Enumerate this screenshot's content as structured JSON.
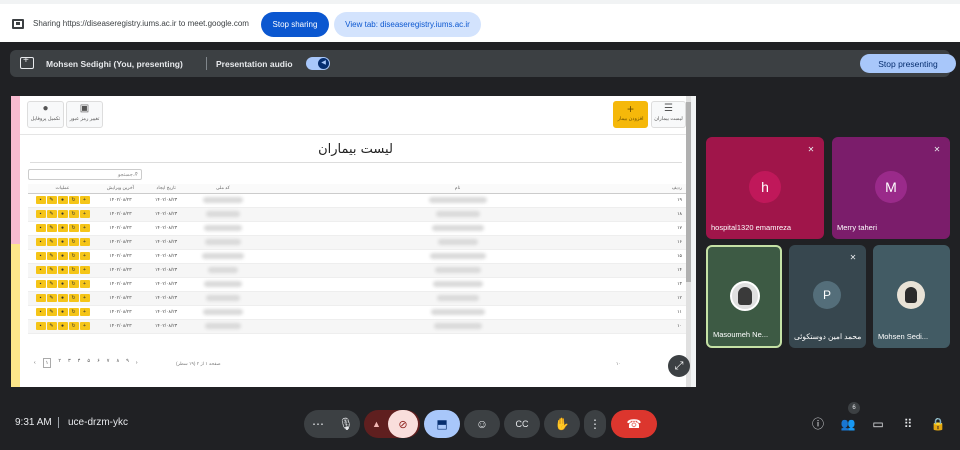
{
  "sharing_bar": {
    "message": "Sharing https://diseaseregistry.iums.ac.ir to meet.google.com",
    "stop_sharing": "Stop sharing",
    "view_tab": "View tab: diseaseregistry.iums.ac.ir"
  },
  "presenting_bar": {
    "presenter": "Mohsen Sedighi (You, presenting)",
    "audio_label": "Presentation audio",
    "stop_presenting": "Stop presenting"
  },
  "app": {
    "title": "لیست بیماران",
    "toolbar": {
      "list_label": "لیست بیماران",
      "add_label": "افزودن بیمار",
      "user_label": "تکمیل پروفایل",
      "password_label": "تغییر رمز عبور"
    },
    "search_placeholder": "جستجو...",
    "columns": [
      "ردیف",
      "نام",
      "کد ملی",
      "تاریخ ایجاد",
      "آخرین ویرایش",
      "عملیات"
    ],
    "rows": [
      {
        "row": "۱۹",
        "created": "۱۴۰۲/۰۸/۲۳",
        "edited": "۱۴۰۲/۰۸/۲۳"
      },
      {
        "row": "۱۸",
        "created": "۱۴۰۲/۰۸/۲۳",
        "edited": "۱۴۰۲/۰۸/۲۳"
      },
      {
        "row": "۱۷",
        "created": "۱۴۰۲/۰۸/۲۳",
        "edited": "۱۴۰۲/۰۸/۲۳"
      },
      {
        "row": "۱۶",
        "created": "۱۴۰۲/۰۸/۲۳",
        "edited": "۱۴۰۲/۰۸/۲۳"
      },
      {
        "row": "۱۵",
        "created": "۱۴۰۲/۰۸/۲۳",
        "edited": "۱۴۰۲/۰۸/۲۳"
      },
      {
        "row": "۱۴",
        "created": "۱۴۰۲/۰۸/۲۳",
        "edited": "۱۴۰۲/۰۸/۲۳"
      },
      {
        "row": "۱۳",
        "created": "۱۴۰۲/۰۸/۲۳",
        "edited": "۱۴۰۲/۰۸/۲۳"
      },
      {
        "row": "۱۲",
        "created": "۱۴۰۲/۰۸/۲۳",
        "edited": "۱۴۰۲/۰۸/۲۳"
      },
      {
        "row": "۱۱",
        "created": "۱۴۰۲/۰۸/۲۳",
        "edited": "۱۴۰۲/۰۸/۲۳"
      },
      {
        "row": "۱۰",
        "created": "۱۴۰۲/۰۸/۲۳",
        "edited": "۱۴۰۲/۰۸/۲۳"
      }
    ],
    "pagination": {
      "pages": [
        "۱",
        "۲",
        "۳",
        "۴",
        "۵",
        "۶",
        "۷",
        "۸",
        "۹"
      ],
      "current": "۱",
      "info": "صفحه ۱ از ۲ (۱۹ سطر)",
      "page_size": "۱۰"
    }
  },
  "participants": [
    {
      "name": "hospital1320 emamreza",
      "initial": "h",
      "muted": true
    },
    {
      "name": "Merry taheri",
      "initial": "M",
      "muted": true
    },
    {
      "name": "Masoumeh Ne...",
      "initial": "",
      "muted": false
    },
    {
      "name": "محمد امین دوستکوئی",
      "initial": "P",
      "muted": true
    },
    {
      "name": "Mohsen Sedi...",
      "initial": "",
      "muted": false
    }
  ],
  "footer": {
    "time": "9:31 AM",
    "meeting_code": "uce-drzm-ykc",
    "people_count": "6"
  },
  "icons": {
    "share": "screen-share-icon",
    "expand": "expand-icon",
    "mic": "mic-icon",
    "camera_off": "camera-off-icon",
    "present": "present-screen-icon",
    "emoji": "emoji-icon",
    "captions": "captions-icon",
    "hand": "raise-hand-icon",
    "more": "more-vert-icon",
    "leave": "call-end-icon",
    "info": "info-icon",
    "people": "people-icon",
    "chat": "chat-icon",
    "activities": "activities-icon",
    "lock": "host-controls-icon"
  },
  "colors": {
    "meet_bg": "#202124",
    "accent_blue": "#0b57d0",
    "leave_red": "#dc362e",
    "action_yellow": "#f5c518"
  }
}
